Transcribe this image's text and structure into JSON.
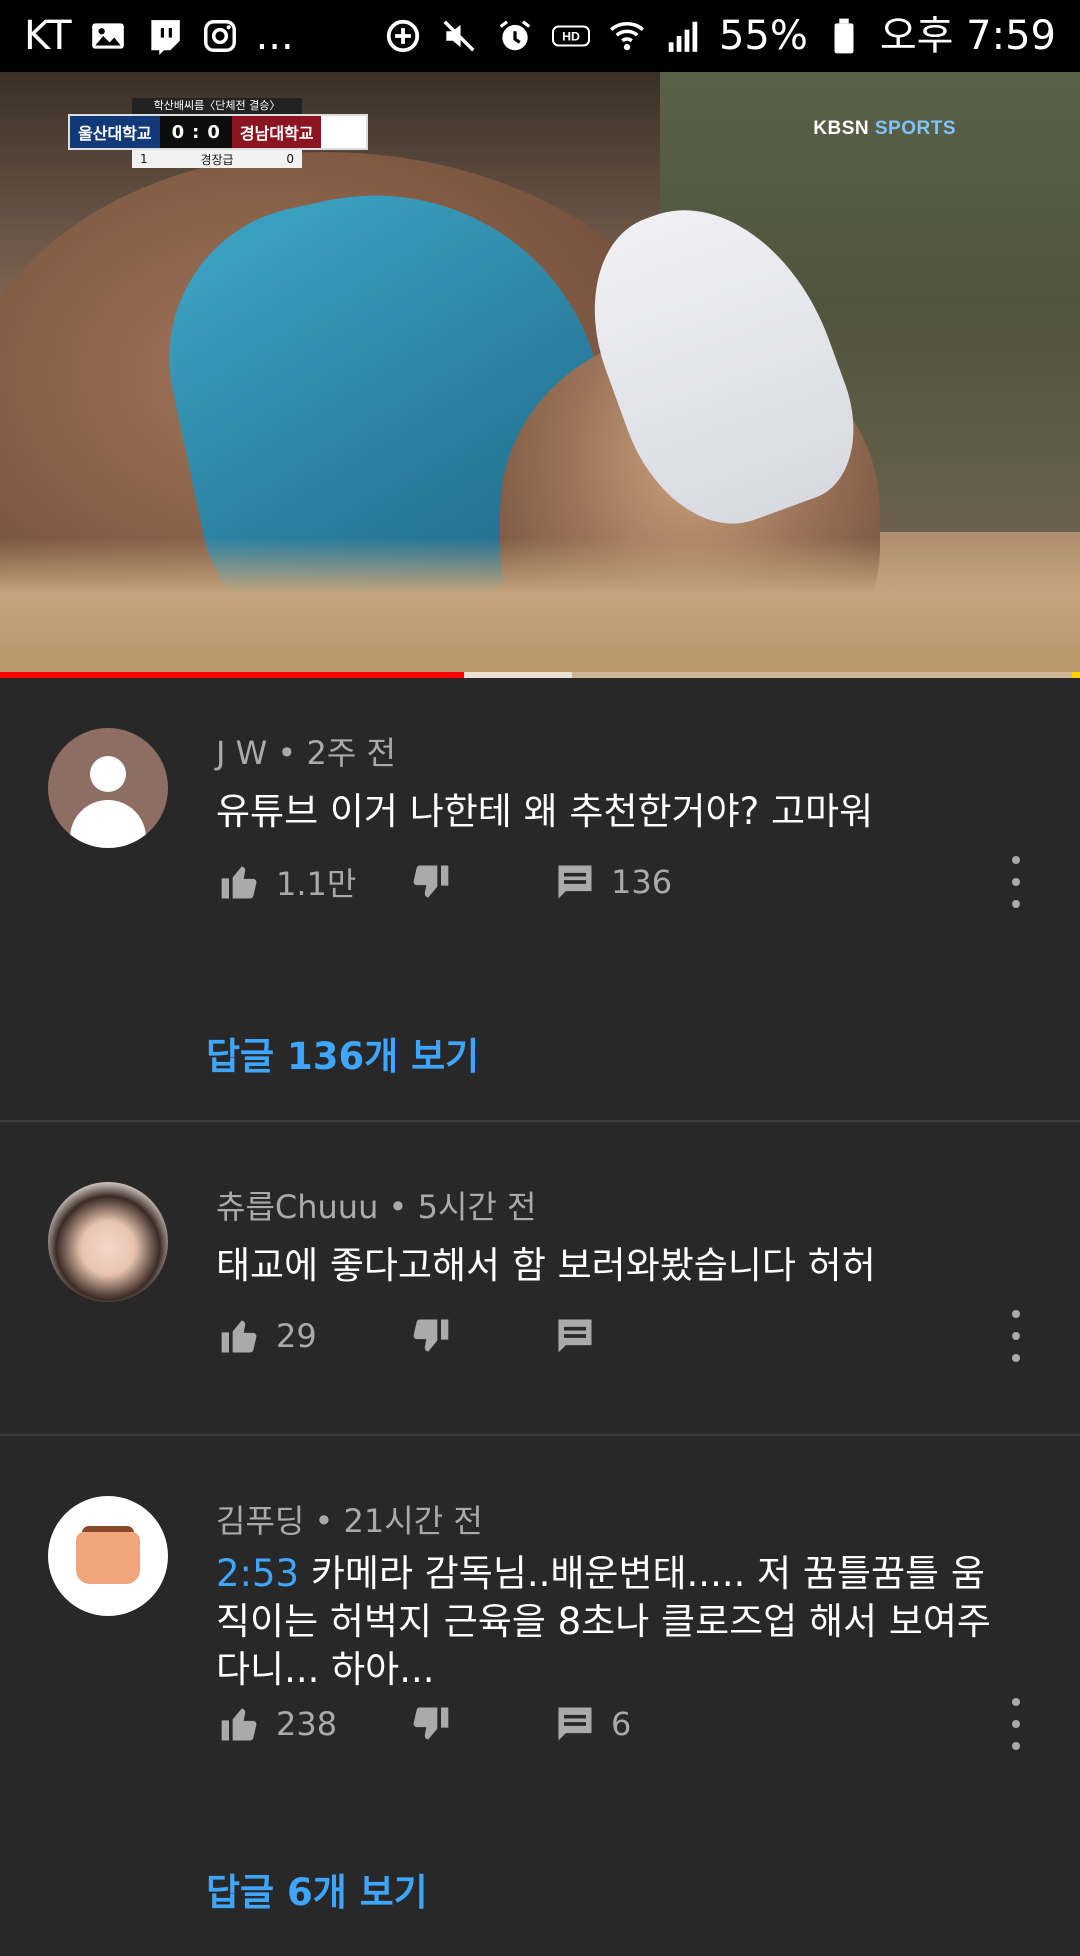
{
  "status_bar": {
    "carrier": "KT",
    "battery_percent": "55%",
    "time": "오후 7:59",
    "more": "...",
    "hd_badge": "HD"
  },
  "video": {
    "scoreboard": {
      "header": "학산배씨름〈단체전 결승〉",
      "team_left": "울산대학교",
      "score_left": "0",
      "score_sep": ":",
      "score_right": "0",
      "team_right": "경남대학교",
      "sub_left": "1",
      "sub_label": "경장급",
      "sub_right": "0"
    },
    "broadcaster_a": "KBSN",
    "broadcaster_b": "SPORTS",
    "progress_played": 0.43,
    "progress_buffered": 0.53
  },
  "comments": [
    {
      "author": "J W",
      "time_ago": "2주 전",
      "text": "유튜브 이거 나한테 왜 추천한거야? 고마워",
      "likes": "1.1만",
      "replies_count": "136",
      "view_replies": "답글 136개 보기"
    },
    {
      "author": "츄릅Chuuu",
      "time_ago": "5시간 전",
      "text": "태교에 좋다고해서 함 보러와봤습니다 허허",
      "likes": "29",
      "replies_count": ""
    },
    {
      "author": "김푸딩",
      "time_ago": "21시간 전",
      "timestamp": "2:53",
      "text": "카메라 감독님..배운변태..... 저 꿈틀꿈틀 움직이는 허벅지 근육을 8초나 클로즈업 해서 보여주다니... 하아...",
      "likes": "238",
      "replies_count": "6",
      "view_replies": "답글 6개 보기"
    }
  ]
}
